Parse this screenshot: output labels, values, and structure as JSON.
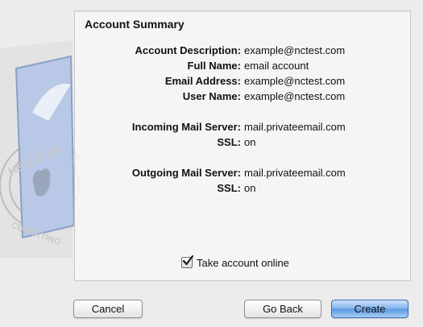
{
  "summary": {
    "title": "Account Summary",
    "rows": [
      {
        "label": "Account Description:",
        "value": "example@nctest.com"
      },
      {
        "label": "Full Name:",
        "value": "email account"
      },
      {
        "label": "Email Address:",
        "value": "example@nctest.com"
      },
      {
        "label": "User Name:",
        "value": "example@nctest.com"
      },
      {
        "label": "Incoming Mail Server:",
        "value": "mail.privateemail.com"
      },
      {
        "label": "SSL:",
        "value": "on"
      },
      {
        "label": "Outgoing Mail Server:",
        "value": "mail.privateemail.com"
      },
      {
        "label": "SSL:",
        "value": "on"
      }
    ]
  },
  "option": {
    "label": "Take account online",
    "checked": true
  },
  "buttons": {
    "cancel": "Cancel",
    "back": "Go Back",
    "create": "Create"
  },
  "colors": {
    "primary_button": "#6aa6ec",
    "background": "#ececec"
  },
  "art": {
    "icon": "mail-stamp-icon"
  }
}
